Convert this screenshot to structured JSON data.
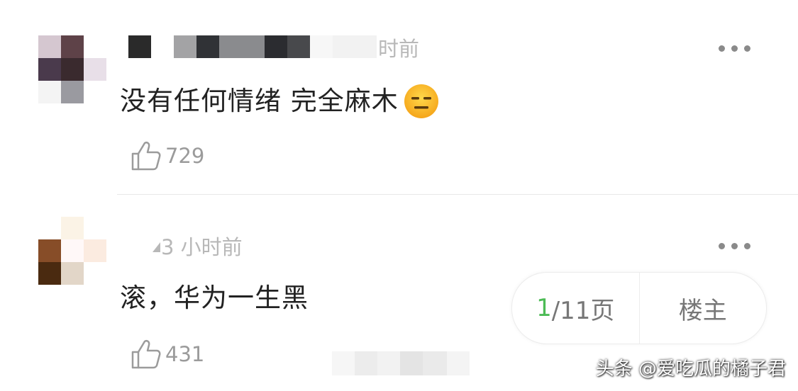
{
  "comments": [
    {
      "time_suffix": "时前",
      "text": "没有任何情绪 完全麻木",
      "emoji": "expressionless-face",
      "likes": "729"
    },
    {
      "time": "3 小时前",
      "text": "滚，华为一生黑",
      "likes": "431"
    }
  ],
  "pager": {
    "current": "1",
    "rest": "/11页",
    "owner_label": "楼主"
  },
  "watermark": "头条 @爱吃瓜的橘子君",
  "colors": {
    "accent_green": "#4cbb55",
    "meta_gray": "#b8b8b8",
    "text_dark": "#222222",
    "emoji_yellow": "#f7b51c"
  }
}
